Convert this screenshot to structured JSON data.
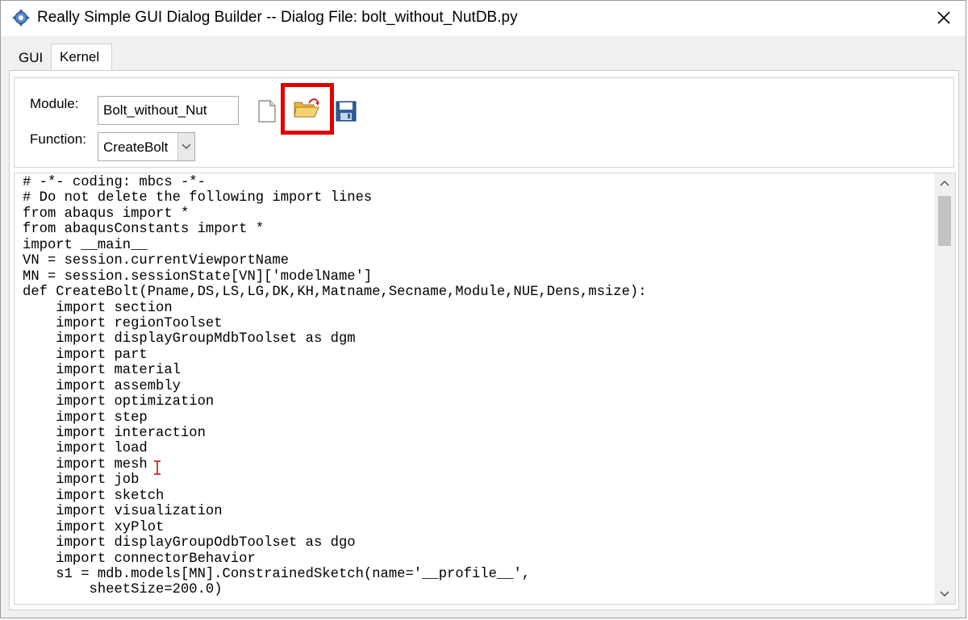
{
  "window": {
    "title": "Really Simple GUI Dialog Builder -- Dialog File: bolt_without_NutDB.py",
    "app_icon": "app-gear-icon",
    "close_icon": "close-icon"
  },
  "tabs": [
    {
      "label": "GUI",
      "active": false
    },
    {
      "label": "Kernel",
      "active": true
    }
  ],
  "form": {
    "module_label": "Module:",
    "module_value": "Bolt_without_Nut",
    "function_label": "Function:",
    "function_value": "CreateBolt"
  },
  "toolbar": {
    "new_icon": "new-file-icon",
    "open_icon": "open-folder-icon",
    "save_icon": "save-floppy-icon",
    "highlight_color": "#e00000"
  },
  "editor": {
    "lines": [
      "# -*- coding: mbcs -*-",
      "# Do not delete the following import lines",
      "from abaqus import *",
      "from abaqusConstants import *",
      "import __main__",
      "VN = session.currentViewportName",
      "MN = session.sessionState[VN]['modelName']",
      "def CreateBolt(Pname,DS,LS,LG,DK,KH,Matname,Secname,Module,NUE,Dens,msize):",
      "    import section",
      "    import regionToolset",
      "    import displayGroupMdbToolset as dgm",
      "    import part",
      "    import material",
      "    import assembly",
      "    import optimization",
      "    import step",
      "    import interaction",
      "    import load",
      "    import mesh",
      "    import job",
      "    import sketch",
      "    import visualization",
      "    import xyPlot",
      "    import displayGroupOdbToolset as dgo",
      "    import connectorBehavior",
      "    s1 = mdb.models[MN].ConstrainedSketch(name='__profile__',",
      "        sheetSize=200.0)"
    ]
  }
}
